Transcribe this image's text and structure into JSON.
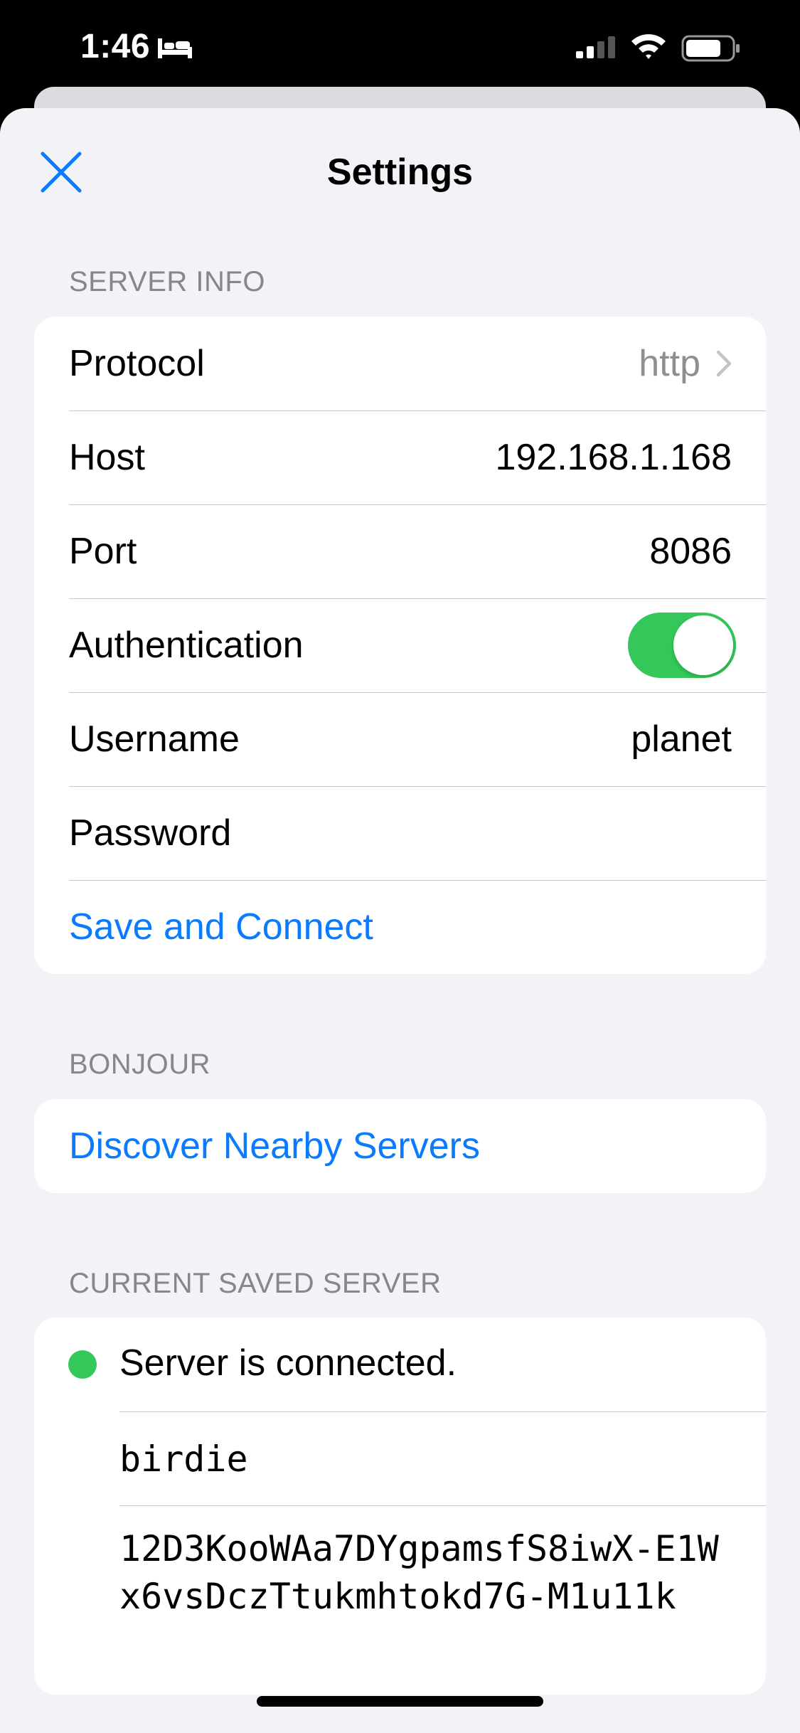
{
  "status_bar": {
    "time": "1:46",
    "icons": [
      "bed-icon",
      "signal-icon",
      "wifi-icon",
      "battery-icon"
    ]
  },
  "nav": {
    "title": "Settings",
    "close_icon": "close-icon"
  },
  "server_info": {
    "header": "SERVER INFO",
    "protocol_label": "Protocol",
    "protocol_value": "http",
    "host_label": "Host",
    "host_value": "192.168.1.168",
    "port_label": "Port",
    "port_value": "8086",
    "auth_label": "Authentication",
    "auth_enabled": true,
    "username_label": "Username",
    "username_value": "planet",
    "password_label": "Password",
    "save_connect_label": "Save and Connect"
  },
  "bonjour": {
    "header": "BONJOUR",
    "discover_label": "Discover Nearby Servers"
  },
  "current_server": {
    "header": "CURRENT SAVED SERVER",
    "status_text": "Server is connected.",
    "name": "birdie",
    "peer_id": "12D3KooWAa7DYgpamsfS8iwX-E1Wx6vsDczTtukmhtokd7G-M1u11k"
  },
  "colors": {
    "accent": "#0a7aff",
    "toggle_on": "#34c759",
    "status_dot": "#34c759",
    "background": "#f2f2f7",
    "secondary_text": "#86868b"
  }
}
